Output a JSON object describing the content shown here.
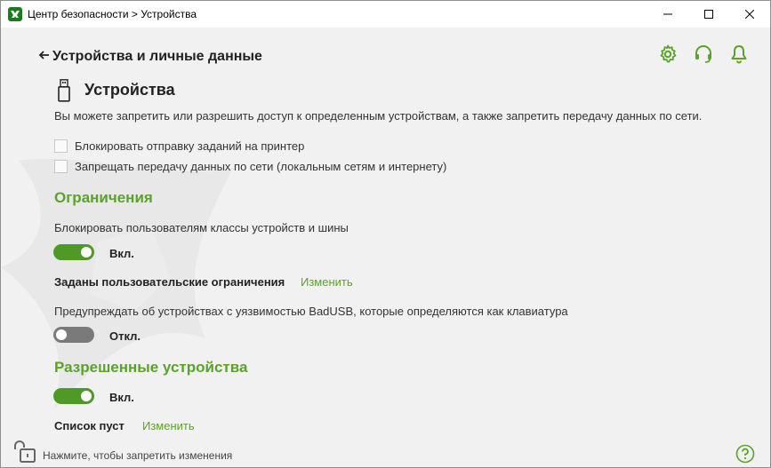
{
  "window": {
    "title": "Центр безопасности > Устройства",
    "controls": {
      "minimize": "minimize-icon",
      "maximize": "maximize-icon",
      "close": "close-icon"
    }
  },
  "header": {
    "back_label": "Устройства и личные данные",
    "icons": [
      "gear-icon",
      "headset-icon",
      "bell-icon"
    ],
    "accent_color": "#5aa32a"
  },
  "section": {
    "icon": "usb-drive-icon",
    "title": "Устройства",
    "description": "Вы можете запретить или разрешить доступ к определенным устройствам, а также запретить передачу данных по сети."
  },
  "checkboxes": [
    {
      "label": "Блокировать отправку заданий на принтер",
      "checked": false
    },
    {
      "label": "Запрещать передачу данных по сети (локальным сетям и интернету)",
      "checked": false
    }
  ],
  "restrictions": {
    "heading": "Ограничения",
    "block_classes_label": "Блокировать пользователям классы устройств и шины",
    "block_classes_toggle": {
      "state": "on",
      "label": "Вкл."
    },
    "custom_limits_label": "Заданы пользовательские ограничения",
    "custom_limits_link": "Изменить",
    "badusb_label": "Предупреждать об устройствах с уязвимостью BadUSB, которые определяются как клавиатура",
    "badusb_toggle": {
      "state": "off",
      "label": "Откл."
    }
  },
  "allowed": {
    "heading": "Разрешенные устройства",
    "toggle": {
      "state": "on",
      "label": "Вкл."
    },
    "list_label": "Список пуст",
    "list_link": "Изменить"
  },
  "footer": {
    "lock_icon": "unlocked-padlock-icon",
    "text": "Нажмите, чтобы запретить изменения",
    "help_icon": "help-icon"
  }
}
